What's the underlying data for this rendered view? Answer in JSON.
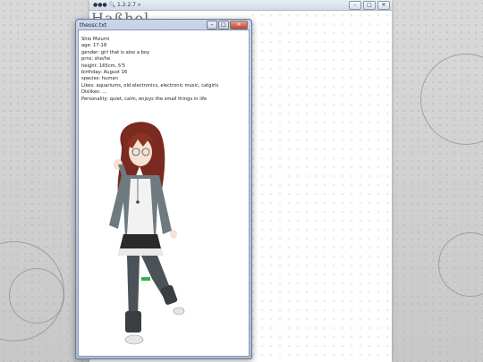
{
  "background_window": {
    "title": "●●● 🔍 1.2.2.7 »",
    "header_text": "Haßhol ...",
    "controls": [
      "–",
      "□",
      "✕"
    ]
  },
  "notepad": {
    "title": "theosc.txt",
    "controls": [
      "–",
      "□",
      "✕"
    ],
    "lines": [
      "Shio Mizumi",
      "age: 17-18",
      "gender: girl that is also a boy",
      "prns: she/he",
      "height: 165cm, 5'5",
      "birthday: August 16",
      "species: human",
      "Likes: aquariums, old electronics, electronic music, catgirls",
      "Dislikes: ...",
      "Personality: quiet, calm, enjoys the small things in life"
    ]
  },
  "colors": {
    "hair": "#7a2a1e",
    "jacket": "#6e7a80",
    "shirt": "#f2f2f2",
    "skirt": "#2a2a2a",
    "leggings": "#4b5358",
    "accent": "#2fb34a"
  },
  "icons": [
    "minimize-icon",
    "maximize-icon",
    "close-icon"
  ]
}
